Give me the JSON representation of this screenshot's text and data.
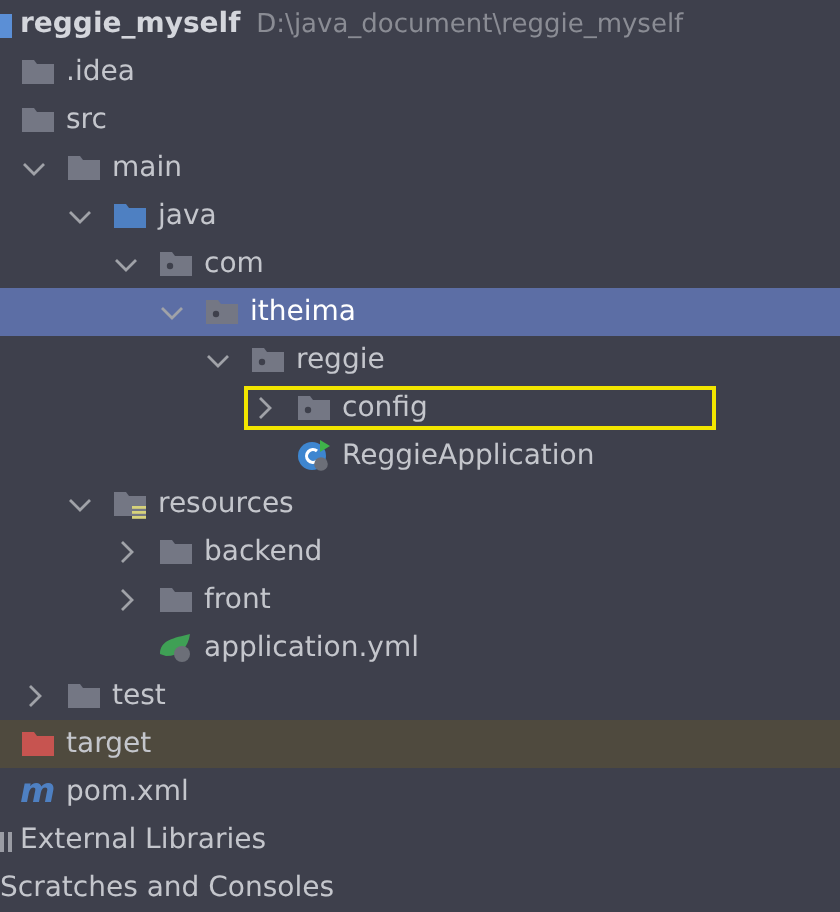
{
  "project": {
    "name": "reggie_myself",
    "path": "D:\\java_document\\reggie_myself"
  },
  "tree": [
    {
      "label": ".idea",
      "kind": "folder"
    },
    {
      "label": "src",
      "kind": "folder",
      "children": [
        {
          "label": "main",
          "kind": "folder",
          "expanded": true,
          "children": [
            {
              "label": "java",
              "kind": "source",
              "expanded": true,
              "children": [
                {
                  "label": "com",
                  "kind": "package",
                  "expanded": true,
                  "children": [
                    {
                      "label": "itheima",
                      "kind": "package",
                      "expanded": true,
                      "selected": true,
                      "children": [
                        {
                          "label": "reggie",
                          "kind": "package",
                          "expanded": true,
                          "selected": false,
                          "children": [
                            {
                              "label": "config",
                              "kind": "package",
                              "expanded": false,
                              "selected": false,
                              "highlighted": true
                            },
                            {
                              "label": "ReggieApplication",
                              "kind": "class",
                              "selected": false
                            }
                          ]
                        }
                      ]
                    }
                  ]
                }
              ]
            },
            {
              "label": "resources",
              "kind": "resources",
              "expanded": true,
              "children": [
                {
                  "label": "backend",
                  "kind": "folder",
                  "expanded": false
                },
                {
                  "label": "front",
                  "kind": "folder",
                  "expanded": false
                },
                {
                  "label": "application.yml",
                  "kind": "yml"
                }
              ]
            }
          ]
        },
        {
          "label": "test",
          "kind": "folder",
          "expanded": false
        }
      ]
    },
    {
      "label": "target",
      "kind": "excluded"
    },
    {
      "label": "pom.xml",
      "kind": "maven",
      "icon": "m"
    }
  ],
  "footer": [
    {
      "label": "External Libraries",
      "kind": "library"
    },
    {
      "label": "Scratches and Consoles",
      "kind": "scratch"
    }
  ]
}
